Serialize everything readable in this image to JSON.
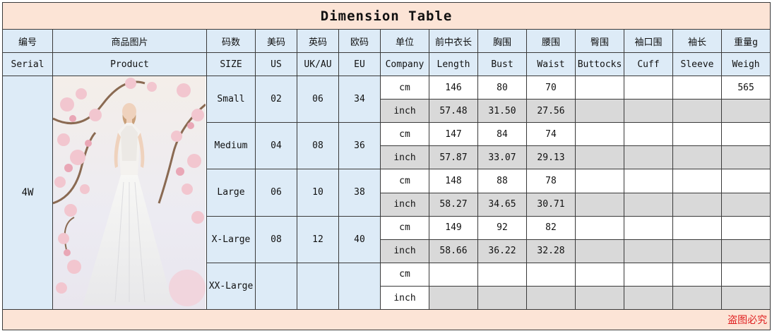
{
  "title": "Dimension Table",
  "headers_cn": [
    "编号",
    "商品图片",
    "码数",
    "美码",
    "英码",
    "欧码",
    "单位",
    "前中衣长",
    "胸围",
    "腰围",
    "臀围",
    "袖口围",
    "袖长",
    "重量g"
  ],
  "headers_en": [
    "Serial",
    "Product",
    "SIZE",
    "US",
    "UK/AU",
    "EU",
    "Company",
    "Length",
    "Bust",
    "Waist",
    "Buttocks",
    "Cuff",
    "Sleeve",
    "Weigh"
  ],
  "serial": "4W",
  "product_image": "white halter lace bridal gown photo",
  "rows": [
    {
      "size": "Small",
      "us": "02",
      "uk": "06",
      "eu": "34",
      "cm": {
        "unit": "cm",
        "length": "146",
        "bust": "80",
        "waist": "70",
        "buttocks": "",
        "cuff": "",
        "sleeve": "",
        "weight": "565"
      },
      "inch": {
        "unit": "inch",
        "length": "57.48",
        "bust": "31.50",
        "waist": "27.56",
        "buttocks": "",
        "cuff": "",
        "sleeve": "",
        "weight": ""
      }
    },
    {
      "size": "Medium",
      "us": "04",
      "uk": "08",
      "eu": "36",
      "cm": {
        "unit": "cm",
        "length": "147",
        "bust": "84",
        "waist": "74",
        "buttocks": "",
        "cuff": "",
        "sleeve": "",
        "weight": ""
      },
      "inch": {
        "unit": "inch",
        "length": "57.87",
        "bust": "33.07",
        "waist": "29.13",
        "buttocks": "",
        "cuff": "",
        "sleeve": "",
        "weight": ""
      }
    },
    {
      "size": "Large",
      "us": "06",
      "uk": "10",
      "eu": "38",
      "cm": {
        "unit": "cm",
        "length": "148",
        "bust": "88",
        "waist": "78",
        "buttocks": "",
        "cuff": "",
        "sleeve": "",
        "weight": ""
      },
      "inch": {
        "unit": "inch",
        "length": "58.27",
        "bust": "34.65",
        "waist": "30.71",
        "buttocks": "",
        "cuff": "",
        "sleeve": "",
        "weight": ""
      }
    },
    {
      "size": "X-Large",
      "us": "08",
      "uk": "12",
      "eu": "40",
      "cm": {
        "unit": "cm",
        "length": "149",
        "bust": "92",
        "waist": "82",
        "buttocks": "",
        "cuff": "",
        "sleeve": "",
        "weight": ""
      },
      "inch": {
        "unit": "inch",
        "length": "58.66",
        "bust": "36.22",
        "waist": "32.28",
        "buttocks": "",
        "cuff": "",
        "sleeve": "",
        "weight": ""
      }
    },
    {
      "size": "XX-Large",
      "us": "",
      "uk": "",
      "eu": "",
      "cm": {
        "unit": "cm",
        "length": "",
        "bust": "",
        "waist": "",
        "buttocks": "",
        "cuff": "",
        "sleeve": "",
        "weight": ""
      },
      "inch": {
        "unit": "inch",
        "length": "",
        "bust": "",
        "waist": "",
        "buttocks": "",
        "cuff": "",
        "sleeve": "",
        "weight": ""
      }
    }
  ],
  "watermark": "盗图必究",
  "colors": {
    "title_bg": "#fce4d6",
    "header_bg": "#ddebf7",
    "inch_row_bg": "#d9d9d9",
    "watermark": "#e02020"
  }
}
